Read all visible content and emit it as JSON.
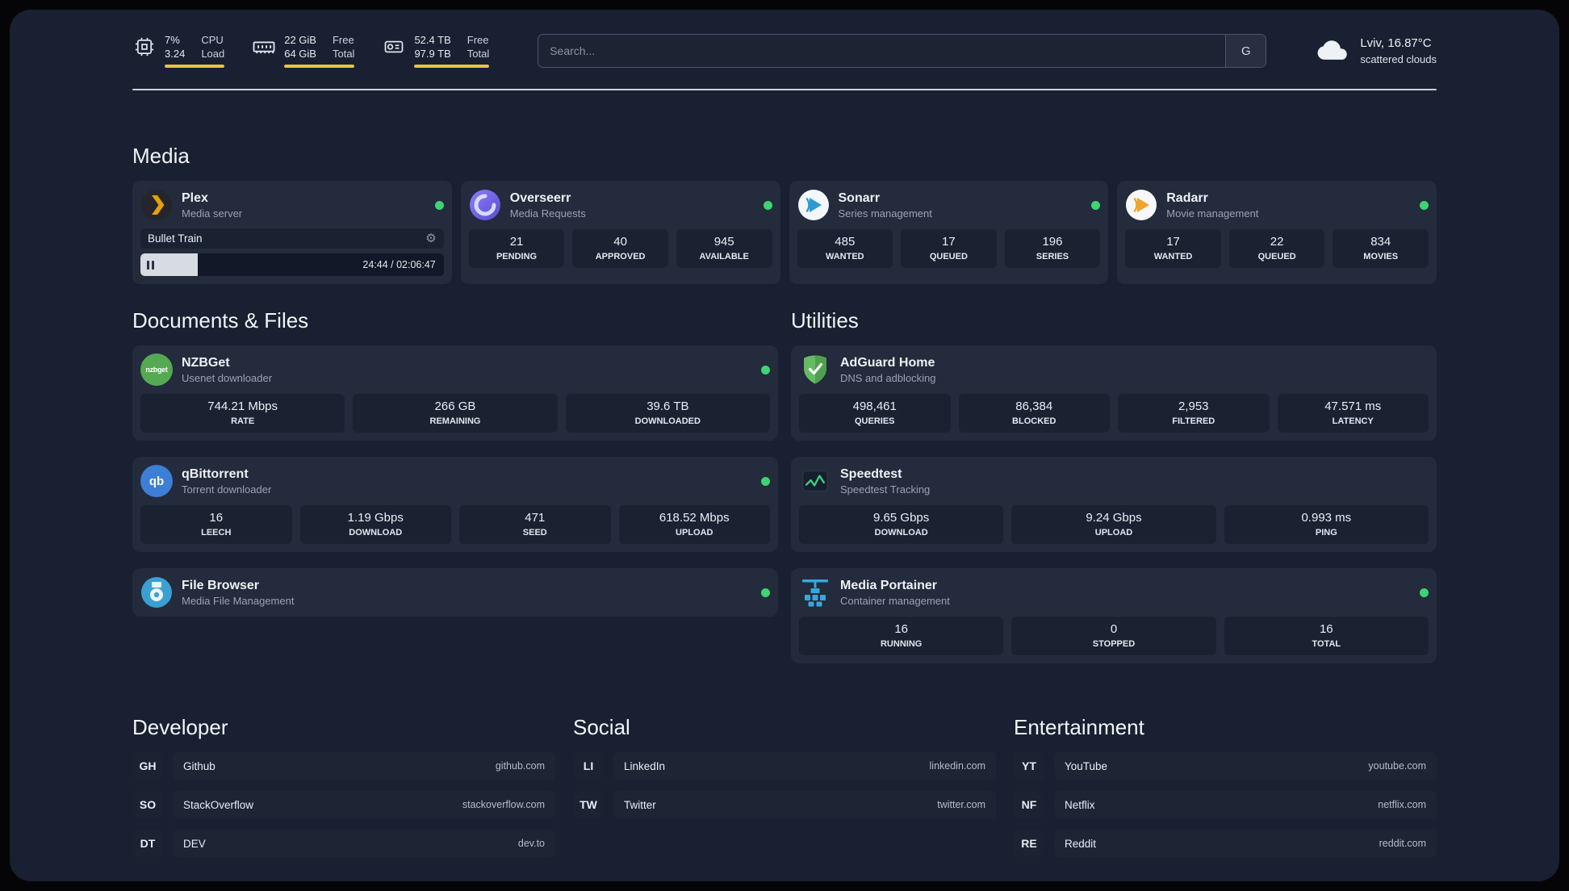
{
  "colors": {
    "accent_yellow": "#e8c445",
    "status_green": "#3ed474",
    "panel_bg": "#182031",
    "card_bg": "#232b3c"
  },
  "header": {
    "cpu": {
      "values": [
        "7%",
        "3.24"
      ],
      "labels": [
        "CPU",
        "Load"
      ]
    },
    "memory": {
      "values": [
        "22 GiB",
        "64 GiB"
      ],
      "labels": [
        "Free",
        "Total"
      ]
    },
    "storage": {
      "values": [
        "52.4 TB",
        "97.9 TB"
      ],
      "labels": [
        "Free",
        "Total"
      ]
    },
    "search": {
      "placeholder": "Search...",
      "engine_label": "G"
    },
    "weather": {
      "location": "Lviv, 16.87°C",
      "condition": "scattered clouds"
    }
  },
  "media": {
    "title": "Media",
    "plex": {
      "name": "Plex",
      "subtitle": "Media server",
      "now_playing": "Bullet Train",
      "time": "24:44 / 02:06:47",
      "progress_percent": 19
    },
    "overseerr": {
      "name": "Overseerr",
      "subtitle": "Media Requests",
      "stats": [
        {
          "value": "21",
          "label": "PENDING"
        },
        {
          "value": "40",
          "label": "APPROVED"
        },
        {
          "value": "945",
          "label": "AVAILABLE"
        }
      ]
    },
    "sonarr": {
      "name": "Sonarr",
      "subtitle": "Series management",
      "stats": [
        {
          "value": "485",
          "label": "WANTED"
        },
        {
          "value": "17",
          "label": "QUEUED"
        },
        {
          "value": "196",
          "label": "SERIES"
        }
      ]
    },
    "radarr": {
      "name": "Radarr",
      "subtitle": "Movie management",
      "stats": [
        {
          "value": "17",
          "label": "WANTED"
        },
        {
          "value": "22",
          "label": "QUEUED"
        },
        {
          "value": "834",
          "label": "MOVIES"
        }
      ]
    }
  },
  "documents": {
    "title": "Documents & Files",
    "nzbget": {
      "name": "NZBGet",
      "subtitle": "Usenet downloader",
      "icon_text": "nzbget",
      "stats": [
        {
          "value": "744.21 Mbps",
          "label": "RATE"
        },
        {
          "value": "266 GB",
          "label": "REMAINING"
        },
        {
          "value": "39.6 TB",
          "label": "DOWNLOADED"
        }
      ]
    },
    "qbittorrent": {
      "name": "qBittorrent",
      "subtitle": "Torrent downloader",
      "icon_text": "qb",
      "stats": [
        {
          "value": "16",
          "label": "LEECH"
        },
        {
          "value": "1.19 Gbps",
          "label": "DOWNLOAD"
        },
        {
          "value": "471",
          "label": "SEED"
        },
        {
          "value": "618.52 Mbps",
          "label": "UPLOAD"
        }
      ]
    },
    "filebrowser": {
      "name": "File Browser",
      "subtitle": "Media File Management"
    }
  },
  "utilities": {
    "title": "Utilities",
    "adguard": {
      "name": "AdGuard Home",
      "subtitle": "DNS and adblocking",
      "stats": [
        {
          "value": "498,461",
          "label": "QUERIES"
        },
        {
          "value": "86,384",
          "label": "BLOCKED"
        },
        {
          "value": "2,953",
          "label": "FILTERED"
        },
        {
          "value": "47.571 ms",
          "label": "LATENCY"
        }
      ]
    },
    "speedtest": {
      "name": "Speedtest",
      "subtitle": "Speedtest Tracking",
      "stats": [
        {
          "value": "9.65 Gbps",
          "label": "DOWNLOAD"
        },
        {
          "value": "9.24 Gbps",
          "label": "UPLOAD"
        },
        {
          "value": "0.993 ms",
          "label": "PING"
        }
      ]
    },
    "portainer": {
      "name": "Media Portainer",
      "subtitle": "Container management",
      "stats": [
        {
          "value": "16",
          "label": "RUNNING"
        },
        {
          "value": "0",
          "label": "STOPPED"
        },
        {
          "value": "16",
          "label": "TOTAL"
        }
      ]
    }
  },
  "bookmarks": {
    "developer": {
      "title": "Developer",
      "items": [
        {
          "abbr": "GH",
          "name": "Github",
          "url": "github.com"
        },
        {
          "abbr": "SO",
          "name": "StackOverflow",
          "url": "stackoverflow.com"
        },
        {
          "abbr": "DT",
          "name": "DEV",
          "url": "dev.to"
        }
      ]
    },
    "social": {
      "title": "Social",
      "items": [
        {
          "abbr": "LI",
          "name": "LinkedIn",
          "url": "linkedin.com"
        },
        {
          "abbr": "TW",
          "name": "Twitter",
          "url": "twitter.com"
        }
      ]
    },
    "entertainment": {
      "title": "Entertainment",
      "items": [
        {
          "abbr": "YT",
          "name": "YouTube",
          "url": "youtube.com"
        },
        {
          "abbr": "NF",
          "name": "Netflix",
          "url": "netflix.com"
        },
        {
          "abbr": "RE",
          "name": "Reddit",
          "url": "reddit.com"
        }
      ]
    }
  }
}
